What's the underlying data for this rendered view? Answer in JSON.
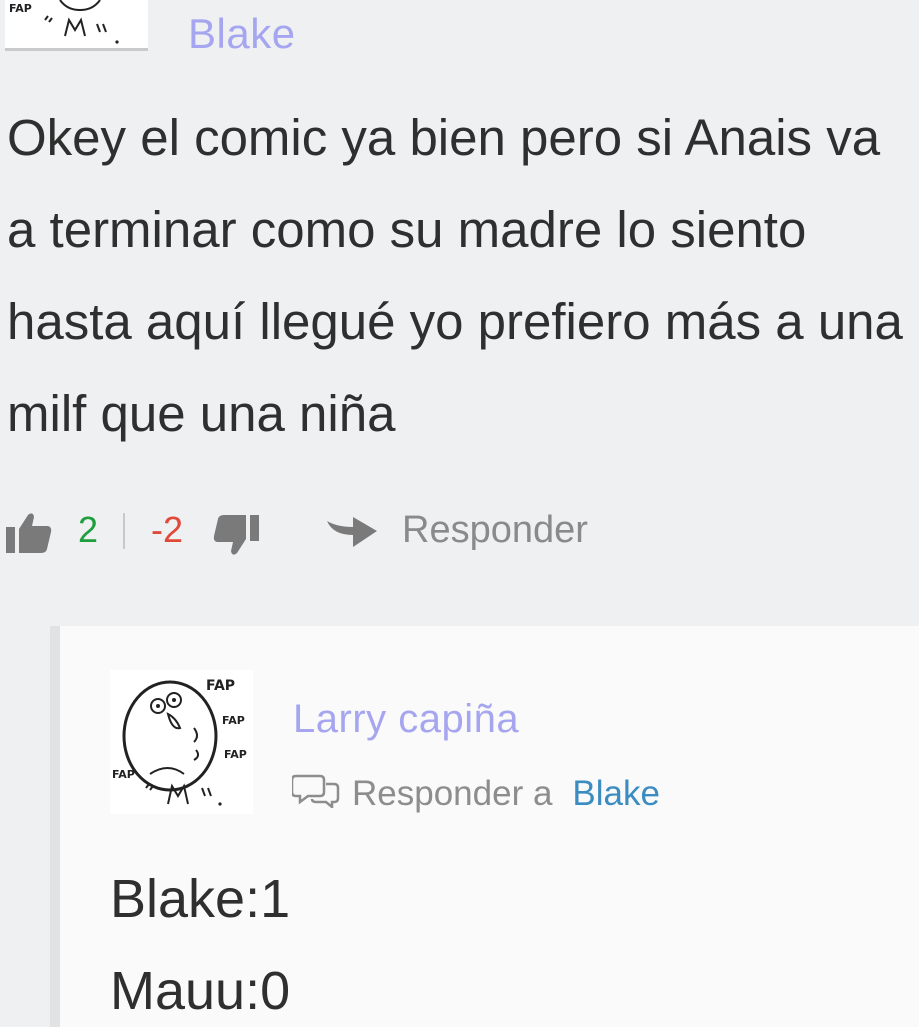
{
  "parent_comment": {
    "author": "Blake",
    "text": "Okey el comic ya bien pero si Anais va a terminar como su madre lo siento hasta aquí llegué yo prefiero más a una milf que una niña",
    "upvotes": "2",
    "downvotes": "-2",
    "reply_label": "Responder",
    "avatar_text": "FAP"
  },
  "reply_comment": {
    "author": "Larry capiña",
    "reply_to_label": "Responder a",
    "reply_to_target": "Blake",
    "avatar_texts": [
      "FAP",
      "FAP",
      "FAP",
      "FAP"
    ],
    "lines": [
      "Blake:1",
      "Mauu:0"
    ]
  },
  "colors": {
    "author": "#a6a6f0",
    "upvote": "#1f9e3d",
    "downvote": "#e0493a",
    "link": "#3b8cc0",
    "text": "#2f2f2f"
  },
  "icons": [
    "thumbs-up-icon",
    "thumbs-down-icon",
    "reply-arrow-icon",
    "chat-bubbles-icon"
  ]
}
